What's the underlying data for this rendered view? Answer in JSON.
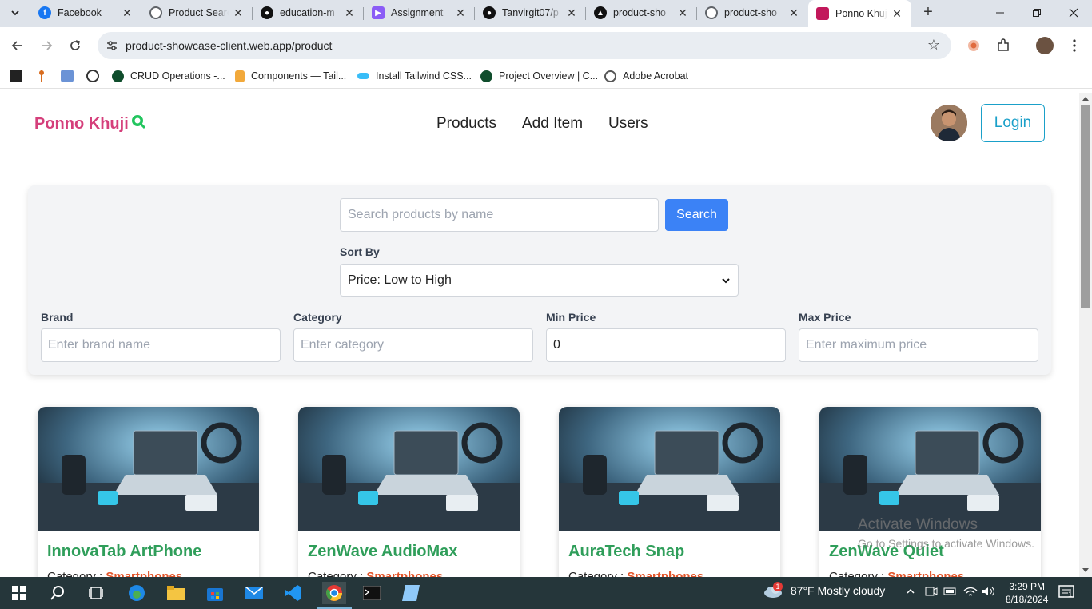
{
  "browser": {
    "tabs": [
      {
        "title": "Facebook",
        "icon": "facebook-icon",
        "color": "#1877f2"
      },
      {
        "title": "Product Search",
        "icon": "chrome-settings-icon",
        "color": "#5f6368"
      },
      {
        "title": "education-m",
        "icon": "github-icon",
        "color": "#111111"
      },
      {
        "title": "Assignment",
        "icon": "assignment-icon",
        "color": "#8b5cf6"
      },
      {
        "title": "Tanvirgit07/p",
        "icon": "github-icon",
        "color": "#111111"
      },
      {
        "title": "product-sho",
        "icon": "vercel-icon",
        "color": "#111111"
      },
      {
        "title": "product-sho",
        "icon": "globe-icon",
        "color": "#5f6368"
      },
      {
        "title": "Ponno Khuji",
        "icon": "ponno-khuji-favicon",
        "color": "#c2185b"
      }
    ],
    "url": "product-showcase-client.web.app/product",
    "bookmarks": [
      {
        "label": "CRUD Operations -...",
        "icon": "mongodb-icon"
      },
      {
        "label": "Components — Tail...",
        "icon": "tailwind-person-icon"
      },
      {
        "label": "Install Tailwind CSS...",
        "icon": "tailwind-icon"
      },
      {
        "label": "Project Overview | C...",
        "icon": "mongodb-icon"
      },
      {
        "label": "Adobe Acrobat",
        "icon": "globe-icon"
      }
    ]
  },
  "site": {
    "logo": "Ponno Khuji",
    "nav": [
      "Products",
      "Add Item",
      "Users"
    ],
    "login": "Login"
  },
  "filters": {
    "search_placeholder": "Search products by name",
    "search_button": "Search",
    "sort_label": "Sort By",
    "sort_value": "Price: Low to High",
    "brand_label": "Brand",
    "brand_placeholder": "Enter brand name",
    "category_label": "Category",
    "category_placeholder": "Enter category",
    "min_label": "Min Price",
    "min_value": "0",
    "max_label": "Max Price",
    "max_placeholder": "Enter maximum price"
  },
  "products": [
    {
      "name": "InnovaTab ArtPhone",
      "category_label": "Category : ",
      "category": "Smartphones"
    },
    {
      "name": "ZenWave AudioMax",
      "category_label": "Category : ",
      "category": "Smartphones"
    },
    {
      "name": "AuraTech Snap",
      "category_label": "Category : ",
      "category": "Smartphones"
    },
    {
      "name": "ZenWave Quiet",
      "category_label": "Category : ",
      "category": "Smartphones"
    }
  ],
  "watermark": {
    "line1": "Activate Windows",
    "line2": "Go to Settings to activate Windows."
  },
  "taskbar": {
    "weather": "87°F  Mostly cloudy",
    "weather_badge": "1",
    "time": "3:29 PM",
    "date": "8/18/2024",
    "notification_count": "1"
  },
  "colors": {
    "brand": "#d53f7b",
    "accent": "#3b82f6",
    "login": "#1aa0c9",
    "product_title": "#2f9e5a",
    "category_value": "#e2552a"
  }
}
